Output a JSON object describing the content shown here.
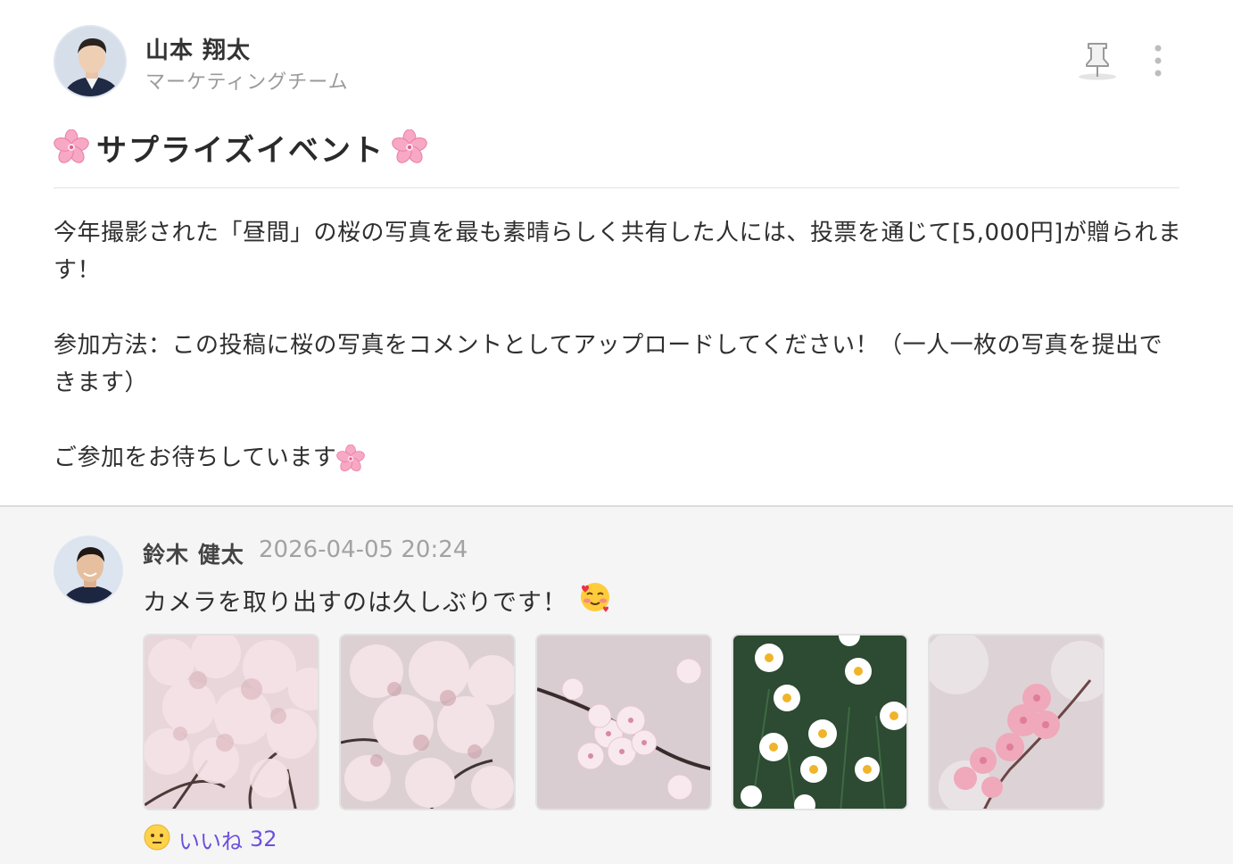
{
  "post": {
    "author": {
      "name": "山本 翔太",
      "team": "マーケティングチーム"
    },
    "title": "サプライズイベント",
    "body": [
      "今年撮影された「昼間」の桜の写真を最も素晴らしく共有した人には、投票を通じて[5,000円]が贈られます！",
      "参加方法：この投稿に桜の写真をコメントとしてアップロードしてください！（一人一枚の写真を提出できます）",
      "ご参加をお待ちしています"
    ],
    "icons": [
      "pushpin-icon",
      "more-vertical-icon",
      "cherry-blossom-icon"
    ]
  },
  "comment": {
    "author": "鈴木 健太",
    "timestamp": "2026-04-05 20:24",
    "text": "カメラを取り出すのは久しぶりです！",
    "photos": [
      {
        "subject": "cherry-blossom-branches"
      },
      {
        "subject": "cherry-blossom-cluster"
      },
      {
        "subject": "cherry-blossom-closeup"
      },
      {
        "subject": "white-daisies"
      },
      {
        "subject": "pink-blossoms"
      }
    ],
    "like": {
      "label": "いいね",
      "count": "32"
    }
  },
  "colors": {
    "accent": "#6b4fe0",
    "muted_text": "#9a9a9a",
    "comment_bg": "#f5f5f5"
  }
}
